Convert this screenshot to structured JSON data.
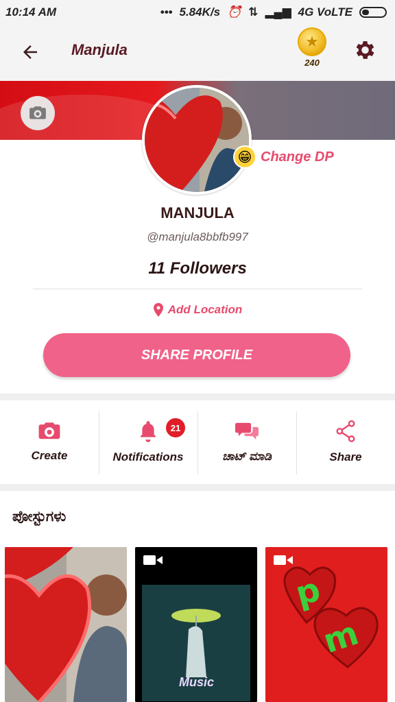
{
  "status_bar": {
    "time": "10:14 AM",
    "network_speed": "5.84K/s",
    "network_type": "4G VoLTE"
  },
  "app_bar": {
    "title": "Manjula",
    "coins": "240"
  },
  "profile": {
    "name": "MANJULA",
    "handle": "@manjula8bbfb997",
    "followers": "11 Followers",
    "change_dp_label": "Change DP",
    "add_location_label": "Add Location",
    "share_profile_label": "SHARE PROFILE"
  },
  "actions": [
    {
      "label": "Create",
      "icon": "camera-icon"
    },
    {
      "label": "Notifications",
      "icon": "bell-icon",
      "badge": "21"
    },
    {
      "label": "ಚಾಟ್ ಮಾಡಿ",
      "icon": "chat-icon"
    },
    {
      "label": "Share",
      "icon": "share-icon"
    }
  ],
  "posts": {
    "title": "ಪೋಸ್ಟುಗಳು",
    "items": [
      {
        "type": "image"
      },
      {
        "type": "video",
        "caption": "Music"
      },
      {
        "type": "video"
      }
    ]
  },
  "colors": {
    "accent_pink": "#f06289",
    "label_pink": "#e64b6d",
    "cover_red": "#d40d14",
    "badge_red": "#e01e2a"
  }
}
